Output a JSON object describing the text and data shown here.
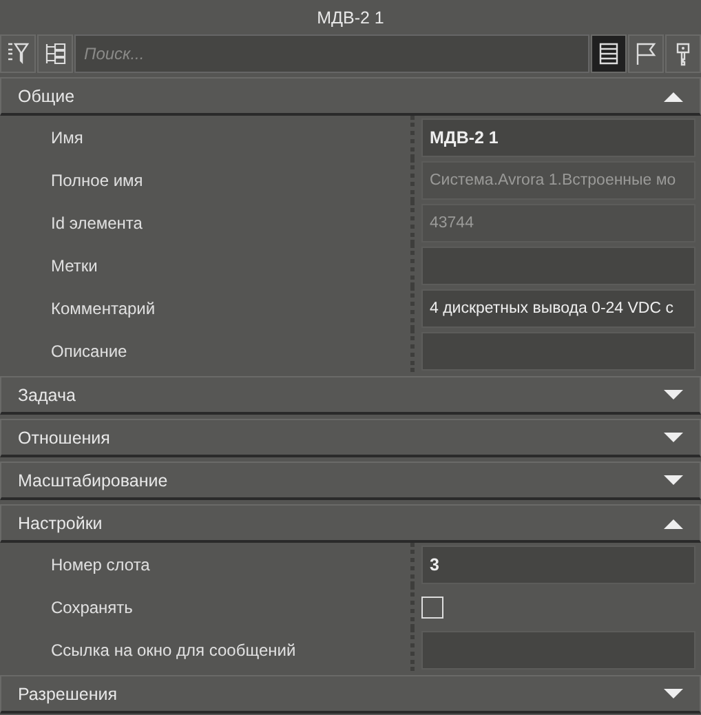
{
  "window": {
    "title": "МДВ-2 1"
  },
  "toolbar": {
    "left_buttons": [
      {
        "kind": "sort-filter"
      },
      {
        "kind": "group"
      }
    ],
    "search": {
      "placeholder": "Поиск..."
    },
    "view_buttons": [
      {
        "kind": "list",
        "selected": true
      },
      {
        "kind": "flag",
        "selected": false
      },
      {
        "kind": "key",
        "selected": false
      }
    ]
  },
  "sections": [
    {
      "title": "Общие",
      "expanded": true,
      "rows": [
        {
          "label": "Имя",
          "kind": "bold",
          "value": "МДВ-2 1"
        },
        {
          "label": "Полное имя",
          "kind": "readonly",
          "value": "Система.Avrora 1.Встроенные мо"
        },
        {
          "label": "Id элемента",
          "kind": "readonly",
          "value": "43744"
        },
        {
          "label": "Метки",
          "kind": "text",
          "value": ""
        },
        {
          "label": "Комментарий",
          "kind": "text",
          "value": "4 дискретных вывода 0-24 VDC с"
        },
        {
          "label": "Описание",
          "kind": "text",
          "value": ""
        }
      ]
    },
    {
      "title": "Задача",
      "expanded": false
    },
    {
      "title": "Отношения",
      "expanded": false
    },
    {
      "title": "Масштабирование",
      "expanded": false
    },
    {
      "title": "Настройки",
      "expanded": true,
      "rows": [
        {
          "label": "Номер слота",
          "kind": "bold",
          "value": "3"
        },
        {
          "label": "Сохранять",
          "kind": "checkbox",
          "checked": false
        },
        {
          "label": "Ссылка на окно для сообщений",
          "kind": "text",
          "value": ""
        }
      ]
    },
    {
      "title": "Разрешения",
      "expanded": false
    }
  ]
}
